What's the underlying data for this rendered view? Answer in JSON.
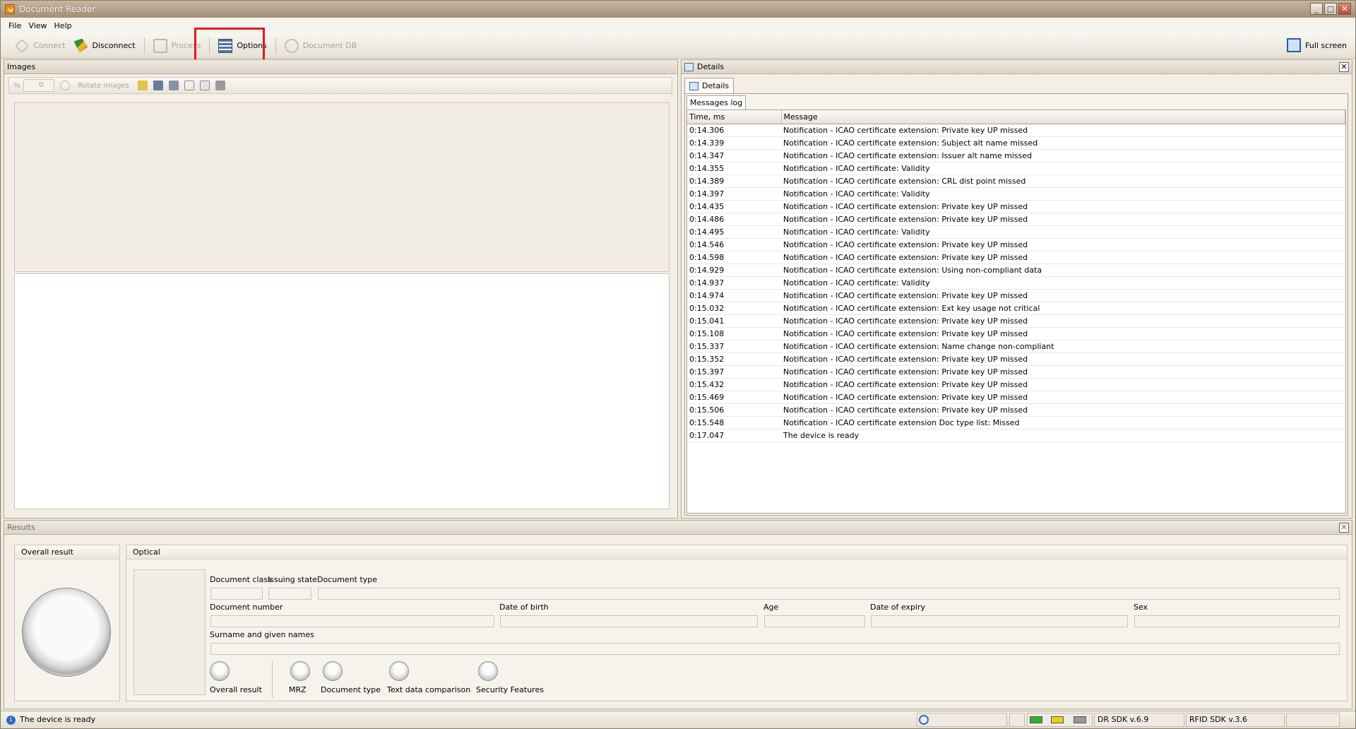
{
  "window": {
    "title": "Document Reader",
    "min": "0",
    "max": "1",
    "close": "r"
  },
  "menu": [
    "File",
    "View",
    "Help"
  ],
  "toolbar": {
    "connect": "Connect",
    "disconnect": "Disconnect",
    "process": "Process",
    "options": "Options",
    "document_db": "Document DB",
    "full_screen": "Full screen"
  },
  "images": {
    "title": "Images",
    "percent": "%",
    "zoom_value": "0",
    "rotate": "Rotate images"
  },
  "details": {
    "title": "Details",
    "tab": "Details",
    "subtab": "Messages log",
    "columns": [
      "Time, ms",
      "Message"
    ],
    "rows": [
      [
        "0:14.306",
        "Notification - ICAO certificate extension: Private key UP missed"
      ],
      [
        "0:14.339",
        "Notification - ICAO certificate extension: Subject alt name missed"
      ],
      [
        "0:14.347",
        "Notification - ICAO certificate extension: Issuer alt name missed"
      ],
      [
        "0:14.355",
        "Notification - ICAO certificate: Validity"
      ],
      [
        "0:14.389",
        "Notification - ICAO certificate extension: CRL dist point missed"
      ],
      [
        "0:14.397",
        "Notification - ICAO certificate: Validity"
      ],
      [
        "0:14.435",
        "Notification - ICAO certificate extension: Private key UP missed"
      ],
      [
        "0:14.486",
        "Notification - ICAO certificate extension: Private key UP missed"
      ],
      [
        "0:14.495",
        "Notification - ICAO certificate: Validity"
      ],
      [
        "0:14.546",
        "Notification - ICAO certificate extension: Private key UP missed"
      ],
      [
        "0:14.598",
        "Notification - ICAO certificate extension: Private key UP missed"
      ],
      [
        "0:14.929",
        "Notification - ICAO certificate extension: Using non-compliant data"
      ],
      [
        "0:14.937",
        "Notification - ICAO certificate: Validity"
      ],
      [
        "0:14.974",
        "Notification - ICAO certificate extension: Private key UP missed"
      ],
      [
        "0:15.032",
        "Notification - ICAO certificate extension: Ext key usage not critical"
      ],
      [
        "0:15.041",
        "Notification - ICAO certificate extension: Private key UP missed"
      ],
      [
        "0:15.108",
        "Notification - ICAO certificate extension: Private key UP missed"
      ],
      [
        "0:15.337",
        "Notification - ICAO certificate extension: Name change non-compliant"
      ],
      [
        "0:15.352",
        "Notification - ICAO certificate extension: Private key UP missed"
      ],
      [
        "0:15.397",
        "Notification - ICAO certificate extension: Private key UP missed"
      ],
      [
        "0:15.432",
        "Notification - ICAO certificate extension: Private key UP missed"
      ],
      [
        "0:15.469",
        "Notification - ICAO certificate extension: Private key UP missed"
      ],
      [
        "0:15.506",
        "Notification - ICAO certificate extension: Private key UP missed"
      ],
      [
        "0:15.548",
        "Notification - ICAO certificate extension Doc type list: Missed"
      ],
      [
        "0:17.047",
        "The device is ready"
      ]
    ]
  },
  "results": {
    "title": "Results",
    "overall_title": "Overall result",
    "optical_title": "Optical",
    "fields": {
      "document_class": "Document class",
      "issuing_state": "Issuing state",
      "document_type": "Document type",
      "document_number": "Document number",
      "date_of_birth": "Date of birth",
      "age": "Age",
      "date_of_expiry": "Date of expiry",
      "sex": "Sex",
      "surname": "Surname and given names"
    },
    "checks": {
      "overall": "Overall result",
      "mrz": "MRZ",
      "document_type": "Document type",
      "text_comparison": "Text data comparison",
      "security": "Security Features"
    }
  },
  "status": {
    "message": "The device is ready",
    "dr_sdk": "DR SDK v.6.9",
    "rfid_sdk": "RFID SDK v.3.6",
    "indicator_colors": [
      "#2fb12b",
      "#e7cf1a",
      "#9a9a9a"
    ]
  }
}
